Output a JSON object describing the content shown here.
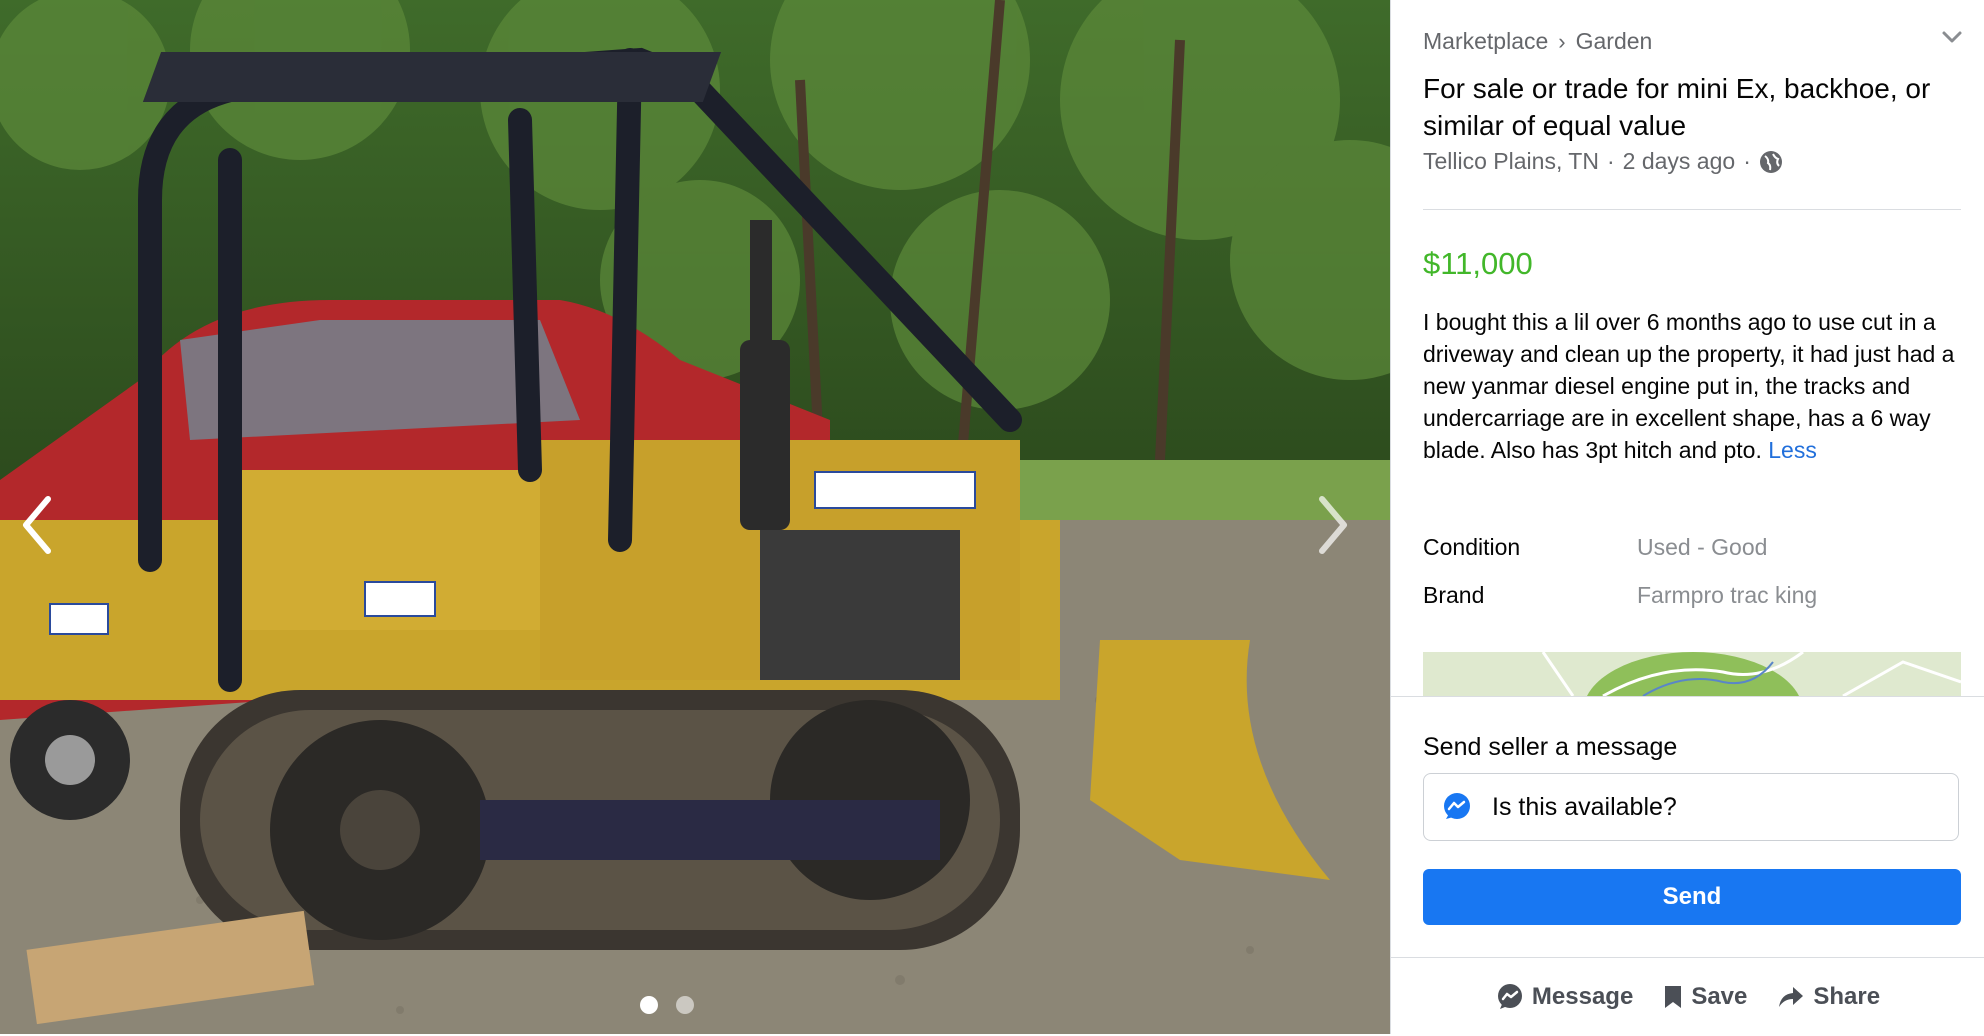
{
  "breadcrumb": {
    "root": "Marketplace",
    "category": "Garden"
  },
  "listing": {
    "title": "For sale or trade for mini Ex, backhoe, or similar of equal value",
    "location": "Tellico Plains, TN",
    "posted": "2 days ago",
    "price": "$11,000",
    "description": "I bought this a lil over 6 months ago to use cut in a driveway and clean up the property, it had just had a new yanmar diesel engine put in, the tracks and undercarriage are in excellent shape, has a 6 way blade. Also has 3pt hitch and pto.",
    "less_link": "Less",
    "details": [
      {
        "label": "Condition",
        "value": "Used - Good"
      },
      {
        "label": "Brand",
        "value": "Farmpro trac king"
      }
    ]
  },
  "photo": {
    "alt_subject": "yellow crawler dozer with red pickup truck behind",
    "current": 1,
    "total": 2
  },
  "message": {
    "label": "Send seller a message",
    "input_value": "Is this available?",
    "send_label": "Send"
  },
  "actions": {
    "message": "Message",
    "save": "Save",
    "share": "Share"
  },
  "colors": {
    "price": "#42b72a",
    "primary": "#1877f2",
    "link": "#216fdb",
    "muted": "#65676b"
  },
  "icons": [
    "chevron-left-icon",
    "chevron-right-icon",
    "chevron-down-icon",
    "globe-icon",
    "messenger-icon",
    "bookmark-icon",
    "share-arrow-icon"
  ]
}
